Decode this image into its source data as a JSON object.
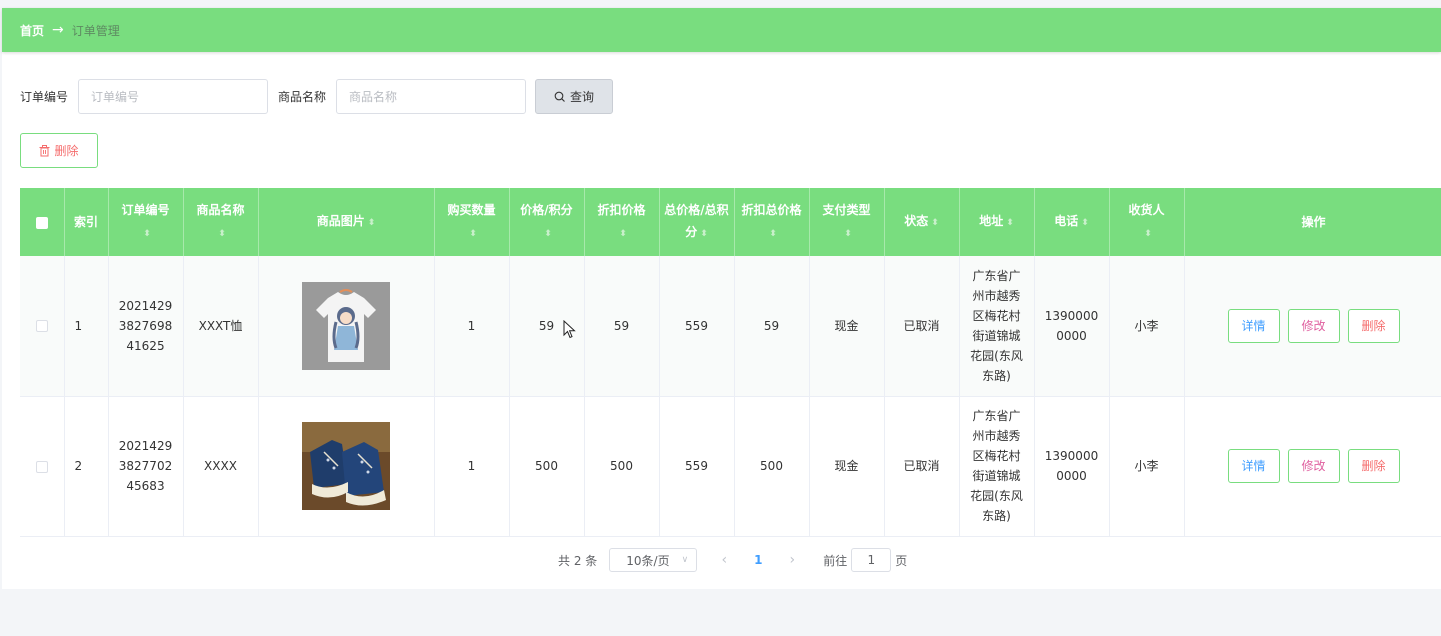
{
  "breadcrumb": {
    "home": "首页",
    "separator": "→",
    "current": "订单管理"
  },
  "search": {
    "order_no_label": "订单编号",
    "order_no_placeholder": "订单编号",
    "product_label": "商品名称",
    "product_placeholder": "商品名称",
    "query_label": "查询"
  },
  "toolbar": {
    "delete_label": "删除"
  },
  "table": {
    "headers": {
      "index": "索引",
      "order_no": "订单编号",
      "product_name": "商品名称",
      "product_image": "商品图片",
      "quantity": "购买数量",
      "price": "价格/积分",
      "discount_price": "折扣价格",
      "total": "总价格/总积分",
      "discount_total": "折扣总价格",
      "pay_type": "支付类型",
      "status": "状态",
      "address": "地址",
      "phone": "电话",
      "receiver": "收货人",
      "actions": "操作"
    },
    "rows": [
      {
        "index": "1",
        "order_no": "2021429382769841625",
        "product_name": "XXXT恤",
        "image_icon": "tshirt-image",
        "quantity": "1",
        "price": "59",
        "discount_price": "59",
        "total": "559",
        "discount_total": "59",
        "pay_type": "现金",
        "status": "已取消",
        "address": "广东省广州市越秀区梅花村街道锦城花园(东风东路)",
        "phone": "13900000000",
        "receiver": "小李"
      },
      {
        "index": "2",
        "order_no": "2021429382770245683",
        "product_name": "XXXX",
        "image_icon": "sneakers-image",
        "quantity": "1",
        "price": "500",
        "discount_price": "500",
        "total": "559",
        "discount_total": "500",
        "pay_type": "现金",
        "status": "已取消",
        "address": "广东省广州市越秀区梅花村街道锦城花园(东风东路)",
        "phone": "13900000000",
        "receiver": "小李"
      }
    ],
    "row_actions": {
      "detail": "详情",
      "edit": "修改",
      "delete": "删除"
    }
  },
  "pagination": {
    "total_text": "共 2 条",
    "page_size": "10条/页",
    "current_page": "1",
    "goto_prefix": "前往",
    "goto_value": "1",
    "goto_suffix": "页"
  },
  "colors": {
    "accent": "#79dd7f",
    "danger": "#f56c6c",
    "primary": "#409eff"
  }
}
